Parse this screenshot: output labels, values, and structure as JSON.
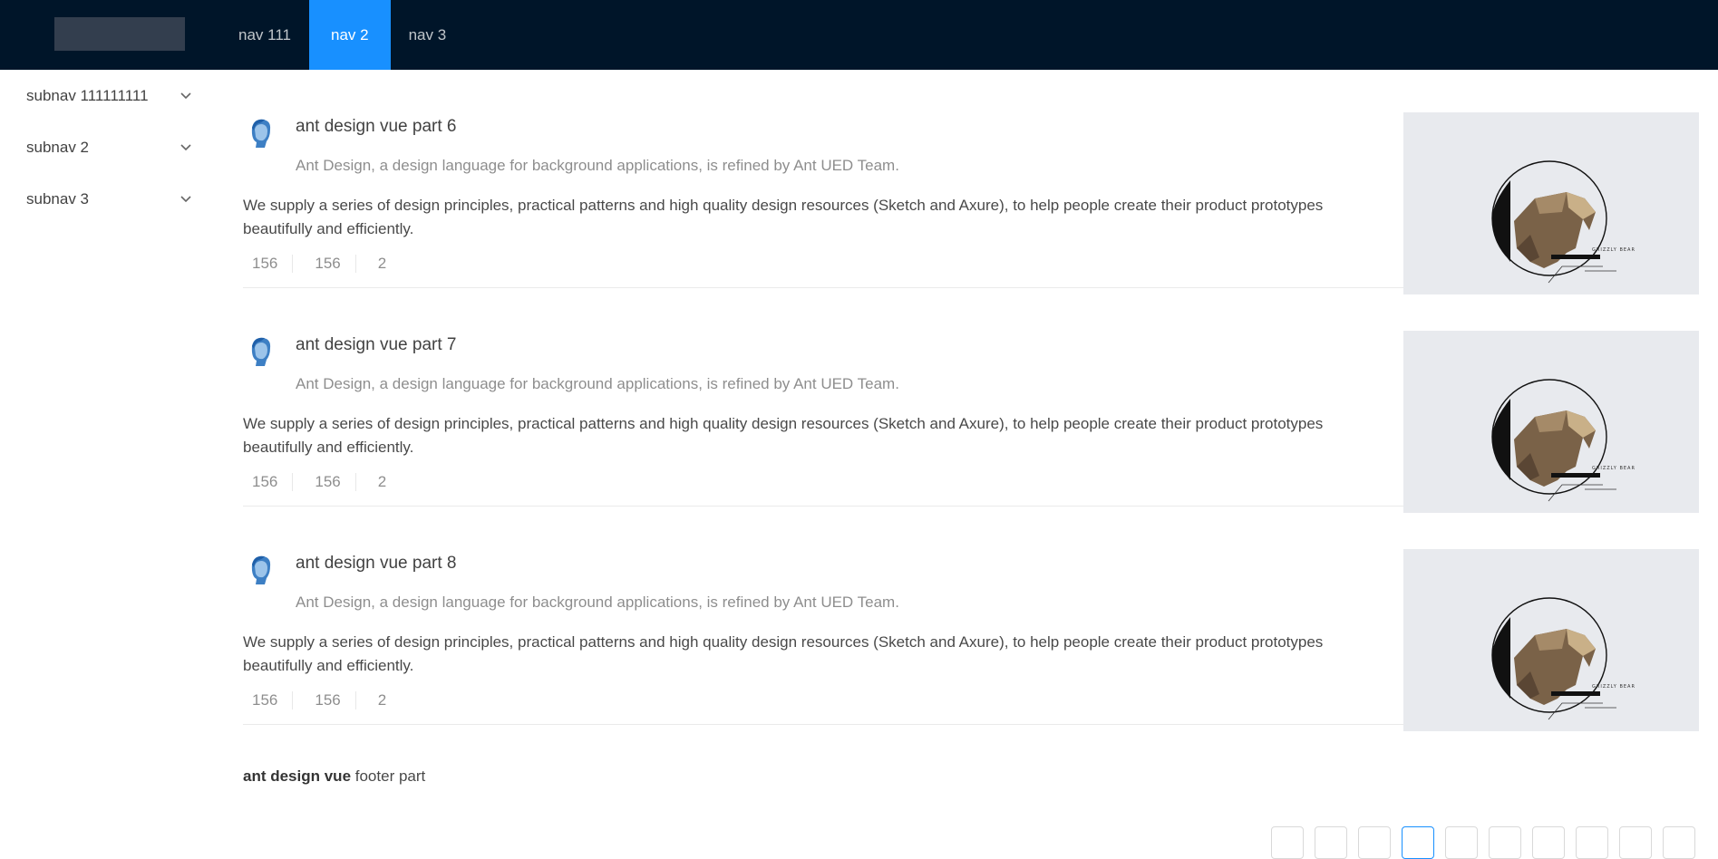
{
  "header": {
    "nav": [
      "nav 111",
      "nav 2",
      "nav 3"
    ]
  },
  "sider": {
    "items": [
      "subnav 111111111",
      "subnav 2",
      "subnav 3"
    ]
  },
  "list": {
    "items": [
      {
        "title": "ant design vue part 6",
        "description": "Ant Design, a design language for background applications, is refined by Ant UED Team.",
        "content": "We supply a series of design principles, practical patterns and high quality design resources (Sketch and Axure), to help people create their product prototypes beautifully and efficiently.",
        "actions": [
          "156",
          "156",
          "2"
        ],
        "cover_label": "GRIZZLY BEAR"
      },
      {
        "title": "ant design vue part 7",
        "description": "Ant Design, a design language for background applications, is refined by Ant UED Team.",
        "content": "We supply a series of design principles, practical patterns and high quality design resources (Sketch and Axure), to help people create their product prototypes beautifully and efficiently.",
        "actions": [
          "156",
          "156",
          "2"
        ],
        "cover_label": "GRIZZLY BEAR"
      },
      {
        "title": "ant design vue part 8",
        "description": "Ant Design, a design language for background applications, is refined by Ant UED Team.",
        "content": "We supply a series of design principles, practical patterns and high quality design resources (Sketch and Axure), to help people create their product prototypes beautifully and efficiently.",
        "actions": [
          "156",
          "156",
          "2"
        ],
        "cover_label": "GRIZZLY BEAR"
      }
    ],
    "footer_bold": "ant design vue",
    "footer_text": " footer part"
  },
  "colors": {
    "header_bg": "#001529",
    "accent": "#1890ff"
  }
}
